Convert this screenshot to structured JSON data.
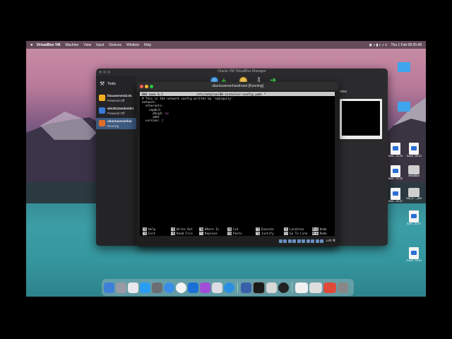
{
  "menubar": {
    "app_name": "VirtualBox VM",
    "menus": [
      "Machine",
      "View",
      "Input",
      "Devices",
      "Window",
      "Help"
    ],
    "clock": "Thu 1 Feb 08:35:48"
  },
  "vbox_manager": {
    "title": "Oracle VM VirtualBox Manager",
    "tools_label": "Tools",
    "preview_label": "view",
    "vms": [
      {
        "name": "linuxserver22.04",
        "state": "Powered Off",
        "color": "#f0b020"
      },
      {
        "name": "win2012androidst",
        "state": "Powered Off",
        "color": "#3a7ad8"
      },
      {
        "name": "ubuntuserverhar",
        "state": "Running",
        "color": "#e06d2a"
      }
    ]
  },
  "vm_window": {
    "title": "ubuntuserverhardreset [Running]",
    "status_text": "Left ⌘"
  },
  "terminal": {
    "header_left": " GNU nano 6.2",
    "header_center": "/etc/netplan/00-installer-config.yaml *",
    "lines": [
      {
        "text": "# This is the network config written by 'subiquity'"
      },
      {
        "text": "network:"
      },
      {
        "text": "  ethernets:"
      },
      {
        "text": "    enp0s3:"
      },
      {
        "text": "      dhcp4: ",
        "num": "no"
      },
      {
        "text": "      addr"
      },
      {
        "text": "  version: ",
        "num": "2"
      }
    ],
    "shortcuts_row1": [
      {
        "key": "^G",
        "label": "Help"
      },
      {
        "key": "^O",
        "label": "Write Out"
      },
      {
        "key": "^W",
        "label": "Where Is"
      },
      {
        "key": "^K",
        "label": "Cut"
      },
      {
        "key": "^T",
        "label": "Execute"
      },
      {
        "key": "^C",
        "label": "Location"
      },
      {
        "key": "M-U",
        "label": "Undo"
      }
    ],
    "shortcuts_row2": [
      {
        "key": "^X",
        "label": "Exit"
      },
      {
        "key": "^R",
        "label": "Read File"
      },
      {
        "key": "^\\",
        "label": "Replace"
      },
      {
        "key": "^U",
        "label": "Paste"
      },
      {
        "key": "^J",
        "label": "Justify"
      },
      {
        "key": "^/",
        "label": "Go To Line"
      },
      {
        "key": "M-E",
        "label": "Redo"
      }
    ]
  },
  "desktop_icons": [
    {
      "label": "",
      "kind": "folder"
    },
    {
      "label": "",
      "kind": "folder"
    },
    {
      "label": "Scre....31.29",
      "kind": "doc"
    },
    {
      "label": "Touch...06.23",
      "kind": "doc"
    },
    {
      "label": "Scre....31.39",
      "kind": "doc"
    },
    {
      "label": "VirtualBox",
      "kind": "drive"
    },
    {
      "label": "Scre....32.07",
      "kind": "doc"
    },
    {
      "label": "VBI_6...._659",
      "kind": "drive"
    },
    {
      "label": "Scre....31.07",
      "kind": "doc"
    },
    {
      "label": "Touch...32.54",
      "kind": "doc"
    }
  ]
}
